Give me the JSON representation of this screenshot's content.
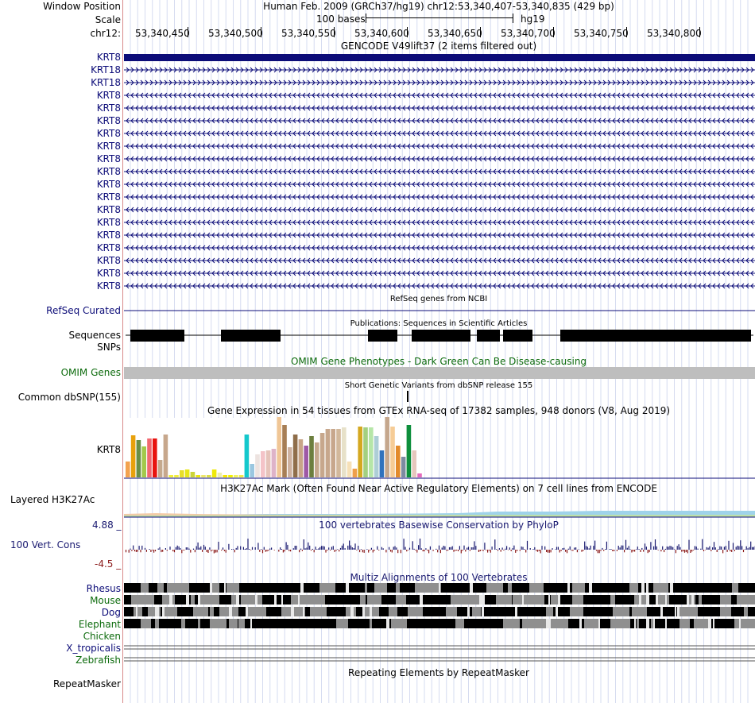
{
  "header": {
    "window_position_label": "Window Position",
    "window_title": "Human Feb. 2009 (GRCh37/hg19)   chr12:53,340,407-53,340,835 (429 bp)",
    "scale_label": "Scale",
    "scale_text": "100 bases",
    "assembly": "hg19",
    "chrom_label": "chr12:",
    "ruler_ticks": [
      "53,340,450",
      "53,340,500",
      "53,340,550",
      "53,340,600",
      "53,340,650",
      "53,340,700",
      "53,340,750",
      "53,340,800"
    ]
  },
  "gencode": {
    "title": "GENCODE V49lift37 (2 items filtered out)",
    "genes": [
      "KRT8",
      "KRT18",
      "KRT18",
      "KRT8",
      "KRT8",
      "KRT8",
      "KRT8",
      "KRT8",
      "KRT8",
      "KRT8",
      "KRT8",
      "KRT8",
      "KRT8",
      "KRT8",
      "KRT8",
      "KRT8",
      "KRT8",
      "KRT8",
      "KRT8"
    ],
    "color": "#0c0c78"
  },
  "refseq": {
    "label": "RefSeq Curated",
    "title": "RefSeq genes from NCBI"
  },
  "publications": {
    "label": "Sequences",
    "title": "Publications: Sequences in Scientific Articles"
  },
  "snps": {
    "label": "SNPs"
  },
  "omim": {
    "label": "OMIM Genes",
    "title": "OMIM Gene Phenotypes - Dark Green Can Be Disease-causing",
    "color": "#0d6b0d"
  },
  "dbsnp": {
    "label": "Common dbSNP(155)",
    "title": "Short Genetic Variants from dbSNP release 155"
  },
  "gtex": {
    "title": "Gene Expression in 54 tissues from GTEx RNA-seq of 17382 samples, 948 donors (V8, Aug 2019)",
    "gene_label": "KRT8"
  },
  "h3k27ac": {
    "label": "Layered H3K27Ac",
    "title": "H3K27Ac Mark (Often Found Near Active Regulatory Elements) on 7 cell lines from ENCODE"
  },
  "conservation": {
    "label": "100 Vert. Cons",
    "title": "100 vertebrates Basewise Conservation by PhyloP",
    "max": "4.88 _",
    "min": "-4.5 _",
    "pos_color": "#191970",
    "neg_color": "#8b1a1a"
  },
  "multiz": {
    "title": "Multiz Alignments of 100 Vertebrates",
    "species": [
      {
        "name": "Rhesus",
        "color": "#0c0c78"
      },
      {
        "name": "Mouse",
        "color": "#0d6b0d"
      },
      {
        "name": "Dog",
        "color": "#0c0c78"
      },
      {
        "name": "Elephant",
        "color": "#0d6b0d"
      },
      {
        "name": "Chicken",
        "color": "#0d6b0d"
      },
      {
        "name": "X_tropicalis",
        "color": "#0c0c78"
      },
      {
        "name": "Zebrafish",
        "color": "#0d6b0d"
      }
    ]
  },
  "repeatmasker": {
    "label": "RepeatMasker",
    "title": "Repeating Elements by RepeatMasker"
  }
}
